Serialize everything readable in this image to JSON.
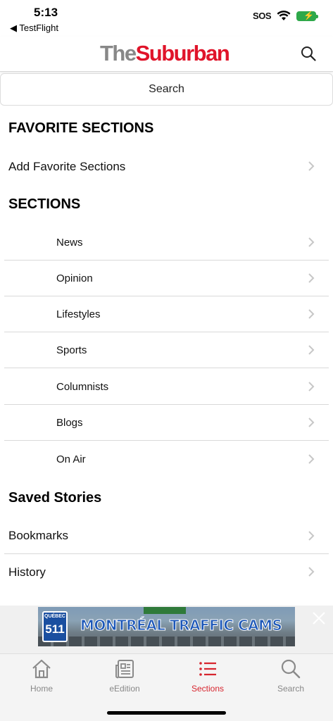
{
  "status_bar": {
    "time": "5:13",
    "back_app": "◀ TestFlight",
    "sos": "SOS",
    "battery_color": "#2ea84a"
  },
  "header": {
    "logo_the": "The",
    "logo_suburban": "Suburban",
    "brand_red": "#e0142a",
    "search_icon": "magnifier-icon"
  },
  "search": {
    "label": "Search"
  },
  "favorites": {
    "heading": "FAVORITE SECTIONS",
    "add_label": "Add Favorite Sections"
  },
  "sections": {
    "heading": "SECTIONS",
    "items": [
      "News",
      "Opinion",
      "Lifestyles",
      "Sports",
      "Columnists",
      "Blogs",
      "On Air"
    ]
  },
  "saved": {
    "heading": "Saved Stories",
    "items": [
      "Bookmarks",
      "History"
    ]
  },
  "ad": {
    "badge_top": "QUÉBEC",
    "badge_number": "511",
    "text": "MONTRÉAL TRAFFIC CAMS"
  },
  "tabbar": {
    "active_color": "#d7262f",
    "tabs": [
      {
        "label": "Home",
        "icon": "house-icon"
      },
      {
        "label": "eEdition",
        "icon": "newspaper-icon"
      },
      {
        "label": "Sections",
        "icon": "list-icon"
      },
      {
        "label": "Search",
        "icon": "magnifier-icon"
      }
    ],
    "active_tab": "Sections"
  }
}
